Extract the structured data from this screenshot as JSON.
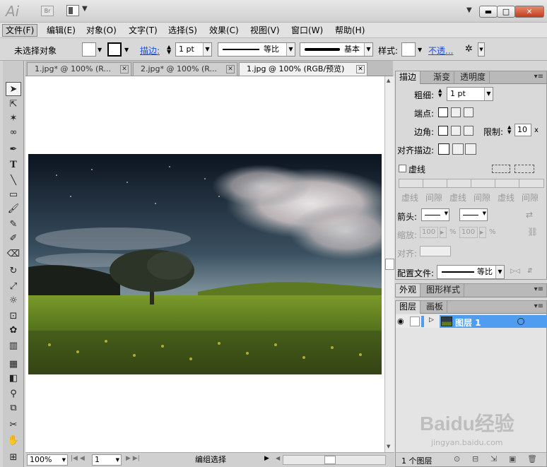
{
  "titlebar": {
    "logo": "Ai",
    "bridge": "Br"
  },
  "menu": [
    "文件(F)",
    "编辑(E)",
    "对象(O)",
    "文字(T)",
    "选择(S)",
    "效果(C)",
    "视图(V)",
    "窗口(W)",
    "帮助(H)"
  ],
  "control": {
    "selection": "未选择对象",
    "stroke_label": "描边:",
    "stroke_weight": "1 pt",
    "profile": "等比",
    "brush": "基本",
    "style_label": "样式:",
    "opacity": "不透..."
  },
  "tabs": [
    {
      "label": "1.jpg* @ 100% (R..."
    },
    {
      "label": "2.jpg* @ 100% (R..."
    },
    {
      "label": "1.jpg @ 100% (RGB/预览)"
    }
  ],
  "status": {
    "zoom": "100%",
    "page": "1",
    "mode": "编组选择"
  },
  "stroke_panel": {
    "tabs": [
      "描边",
      "渐变",
      "透明度"
    ],
    "weight_label": "粗细:",
    "weight": "1 pt",
    "cap_label": "端点:",
    "corner_label": "边角:",
    "limit_label": "限制:",
    "limit": "10",
    "limit_unit": "x",
    "align_label": "对齐描边:",
    "dashed_label": "虚线",
    "dash_labels": [
      "虚线",
      "间隙",
      "虚线",
      "间隙",
      "虚线",
      "间隙"
    ],
    "arrow_label": "箭头:",
    "scale_label": "缩放:",
    "scale_a": "100",
    "scale_b": "100",
    "pct": "%",
    "align2_label": "对齐:",
    "profile_label": "配置文件:",
    "profile": "等比"
  },
  "appearance_panel": {
    "tabs": [
      "外观",
      "图形样式"
    ]
  },
  "layers_panel": {
    "tabs": [
      "图层",
      "画板"
    ],
    "layers": [
      {
        "name": "图层 1"
      }
    ],
    "footer": "1 个图层"
  },
  "watermark": {
    "text": "Baidu经验",
    "url": "jingyan.baidu.com"
  },
  "colors": {
    "layer_highlight": "#4f9cf0",
    "close": "#c9432a",
    "link": "#1e4fd8"
  }
}
